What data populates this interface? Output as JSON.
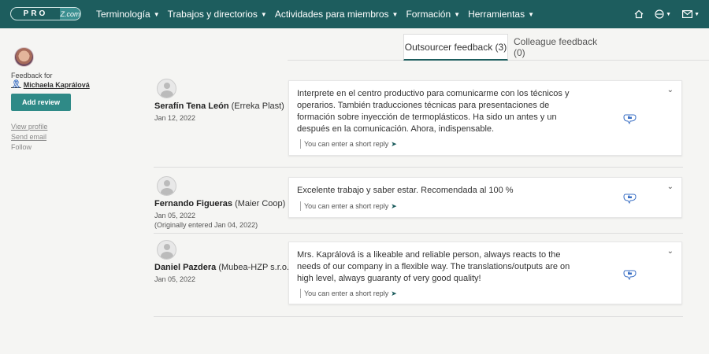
{
  "brand": {
    "logo_left": "PRO",
    "logo_right": "Z.com"
  },
  "nav": [
    {
      "label": "Terminología"
    },
    {
      "label": "Trabajos y directorios"
    },
    {
      "label": "Actividades para miembros"
    },
    {
      "label": "Formación"
    },
    {
      "label": "Herramientas"
    }
  ],
  "top_icons": [
    "home-icon",
    "help-icon",
    "mail-icon"
  ],
  "tabs": {
    "active": "Outsourcer feedback (3)",
    "inactive": "Colleague feedback (0)"
  },
  "sidebar": {
    "feedback_for": "Feedback for",
    "name": "Michaela Kaprálová",
    "add_review": "Add review",
    "links": [
      "View profile",
      "Send email",
      "Follow"
    ]
  },
  "reply_label": "You can enter a short reply",
  "reviews": [
    {
      "name": "Serafín Tena León",
      "company": "(Erreka Plast)",
      "date": "Jan 12, 2022",
      "date2": "",
      "text": "Interprete en el centro productivo para comunicarme con los técnicos y operarios. También traducciones técnicas para presentaciones de formación sobre inyección de termoplásticos. Ha sido un antes y un después en la comunicación. Ahora, indispensable."
    },
    {
      "name": "Fernando Figueras",
      "company": "(Maier Coop)",
      "date": "Jan 05, 2022",
      "date2": "(Originally entered Jan 04, 2022)",
      "text": "Excelente trabajo y saber estar. Recomendada al 100 %"
    },
    {
      "name": "Daniel Pazdera",
      "company": "(Mubea-HZP s.r.o.)",
      "date": "Jan 05, 2022",
      "date2": "",
      "text": "Mrs. Kaprálová is a likeable and reliable person, always reacts to the needs of our company in a flexible way. The translations/outputs are on high level, always guaranty of very good quality!"
    }
  ],
  "colors": {
    "header": "#1d5d5e",
    "accent": "#2f8a87",
    "like": "#3a6fc4"
  }
}
